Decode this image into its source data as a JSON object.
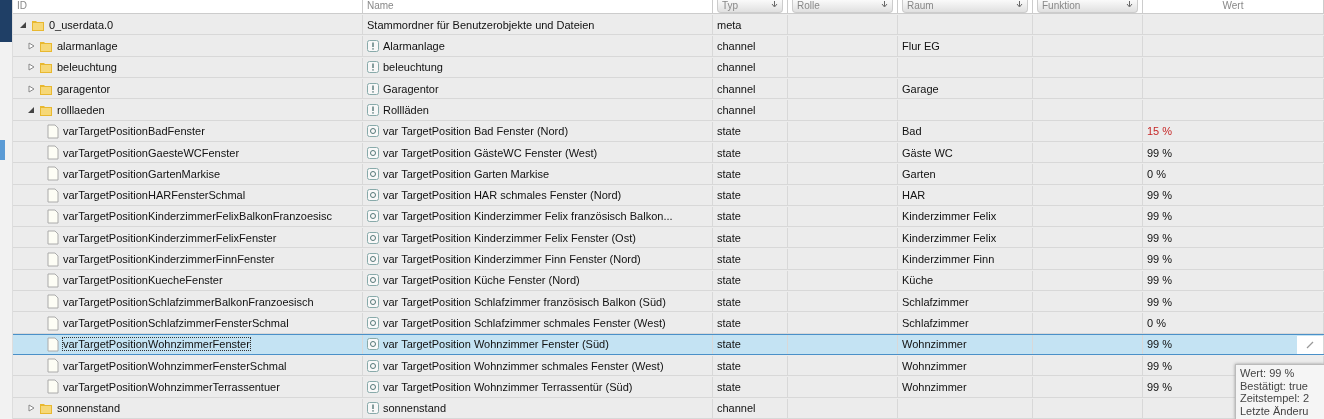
{
  "table": {
    "columns": [
      {
        "label": "ID",
        "kind": "input"
      },
      {
        "label": "Name",
        "kind": "input"
      },
      {
        "label": "Typ",
        "kind": "select"
      },
      {
        "label": "Rolle",
        "kind": "select"
      },
      {
        "label": "Raum",
        "kind": "select"
      },
      {
        "label": "Funktion",
        "kind": "select"
      },
      {
        "label": "Wert",
        "kind": "plain"
      }
    ],
    "rows": [
      {
        "id": "0_userdata.0",
        "kind": "root",
        "name": "Stammordner für Benutzerobjekte und Dateien",
        "type": "meta",
        "expanded": true,
        "selected": false,
        "children": [
          {
            "id": "alarmanlage",
            "kind": "channel",
            "name": "Alarmanlage",
            "type": "channel",
            "room": "Flur EG",
            "expanded": false,
            "selected": false
          },
          {
            "id": "beleuchtung",
            "kind": "channel",
            "name": "beleuchtung",
            "type": "channel",
            "expanded": false,
            "selected": false
          },
          {
            "id": "garagentor",
            "kind": "channel",
            "name": "Garagentor",
            "type": "channel",
            "room": "Garage",
            "expanded": false,
            "selected": false
          },
          {
            "id": "rolllaeden",
            "kind": "channel",
            "name": "Rollläden",
            "type": "channel",
            "expanded": true,
            "selected": false,
            "children": [
              {
                "id": "varTargetPositionBadFenster",
                "kind": "state",
                "name": "var TargetPosition Bad Fenster (Nord)",
                "type": "state",
                "room": "Bad",
                "value": "15 %",
                "warning": true,
                "selected": false
              },
              {
                "id": "varTargetPositionGaesteWCFenster",
                "kind": "state",
                "name": "var TargetPosition GästeWC Fenster (West)",
                "type": "state",
                "room": "Gäste WC",
                "value": "99 %",
                "warning": false,
                "selected": false
              },
              {
                "id": "varTargetPositionGartenMarkise",
                "kind": "state",
                "name": "var TargetPosition Garten Markise",
                "type": "state",
                "room": "Garten",
                "value": "0 %",
                "warning": false,
                "selected": false
              },
              {
                "id": "varTargetPositionHARFensterSchmal",
                "kind": "state",
                "name": "var TargetPosition HAR schmales Fenster (Nord)",
                "type": "state",
                "room": "HAR",
                "value": "99 %",
                "warning": false,
                "selected": false
              },
              {
                "id": "varTargetPositionKinderzimmerFelixBalkonFranzoesisc",
                "kind": "state",
                "name": "var TargetPosition Kinderzimmer Felix französisch Balkon...",
                "type": "state",
                "room": "Kinderzimmer Felix",
                "value": "99 %",
                "warning": false,
                "selected": false
              },
              {
                "id": "varTargetPositionKinderzimmerFelixFenster",
                "kind": "state",
                "name": "var TargetPosition Kinderzimmer Felix Fenster (Ost)",
                "type": "state",
                "room": "Kinderzimmer Felix",
                "value": "99 %",
                "warning": false,
                "selected": false
              },
              {
                "id": "varTargetPositionKinderzimmerFinnFenster",
                "kind": "state",
                "name": "var TargetPosition Kinderzimmer Finn Fenster (Nord)",
                "type": "state",
                "room": "Kinderzimmer Finn",
                "value": "99 %",
                "warning": false,
                "selected": false
              },
              {
                "id": "varTargetPositionKuecheFenster",
                "kind": "state",
                "name": "var TargetPosition Küche Fenster (Nord)",
                "type": "state",
                "room": "Küche",
                "value": "99 %",
                "warning": false,
                "selected": false
              },
              {
                "id": "varTargetPositionSchlafzimmerBalkonFranzoesisch",
                "kind": "state",
                "name": "var TargetPosition Schlafzimmer französisch Balkon (Süd)",
                "type": "state",
                "room": "Schlafzimmer",
                "value": "99 %",
                "warning": false,
                "selected": false
              },
              {
                "id": "varTargetPositionSchlafzimmerFensterSchmal",
                "kind": "state",
                "name": "var TargetPosition Schlafzimmer schmales Fenster (West)",
                "type": "state",
                "room": "Schlafzimmer",
                "value": "0 %",
                "warning": false,
                "selected": false
              },
              {
                "id": "varTargetPositionWohnzimmerFenster",
                "kind": "state",
                "name": "var TargetPosition Wohnzimmer Fenster (Süd)",
                "type": "state",
                "room": "Wohnzimmer",
                "value": "99 %",
                "warning": false,
                "selected": true
              },
              {
                "id": "varTargetPositionWohnzimmerFensterSchmal",
                "kind": "state",
                "name": "var TargetPosition Wohnzimmer schmales Fenster (West)",
                "type": "state",
                "room": "Wohnzimmer",
                "value": "99 %",
                "warning": false,
                "selected": false
              },
              {
                "id": "varTargetPositionWohnzimmerTerrassentuer",
                "kind": "state",
                "name": "var TargetPosition Wohnzimmer Terrassentür (Süd)",
                "type": "state",
                "room": "Wohnzimmer",
                "value": "99 %",
                "warning": false,
                "selected": false
              }
            ]
          },
          {
            "id": "sonnenstand",
            "kind": "channel",
            "name": "sonnenstand",
            "type": "channel",
            "expanded": false,
            "selected": false
          }
        ]
      }
    ]
  },
  "tooltip": {
    "lines": [
      "Wert: 99 %",
      "Bestätigt: true",
      "Zeitstempel: 2",
      "Letzte Änderu"
    ]
  }
}
